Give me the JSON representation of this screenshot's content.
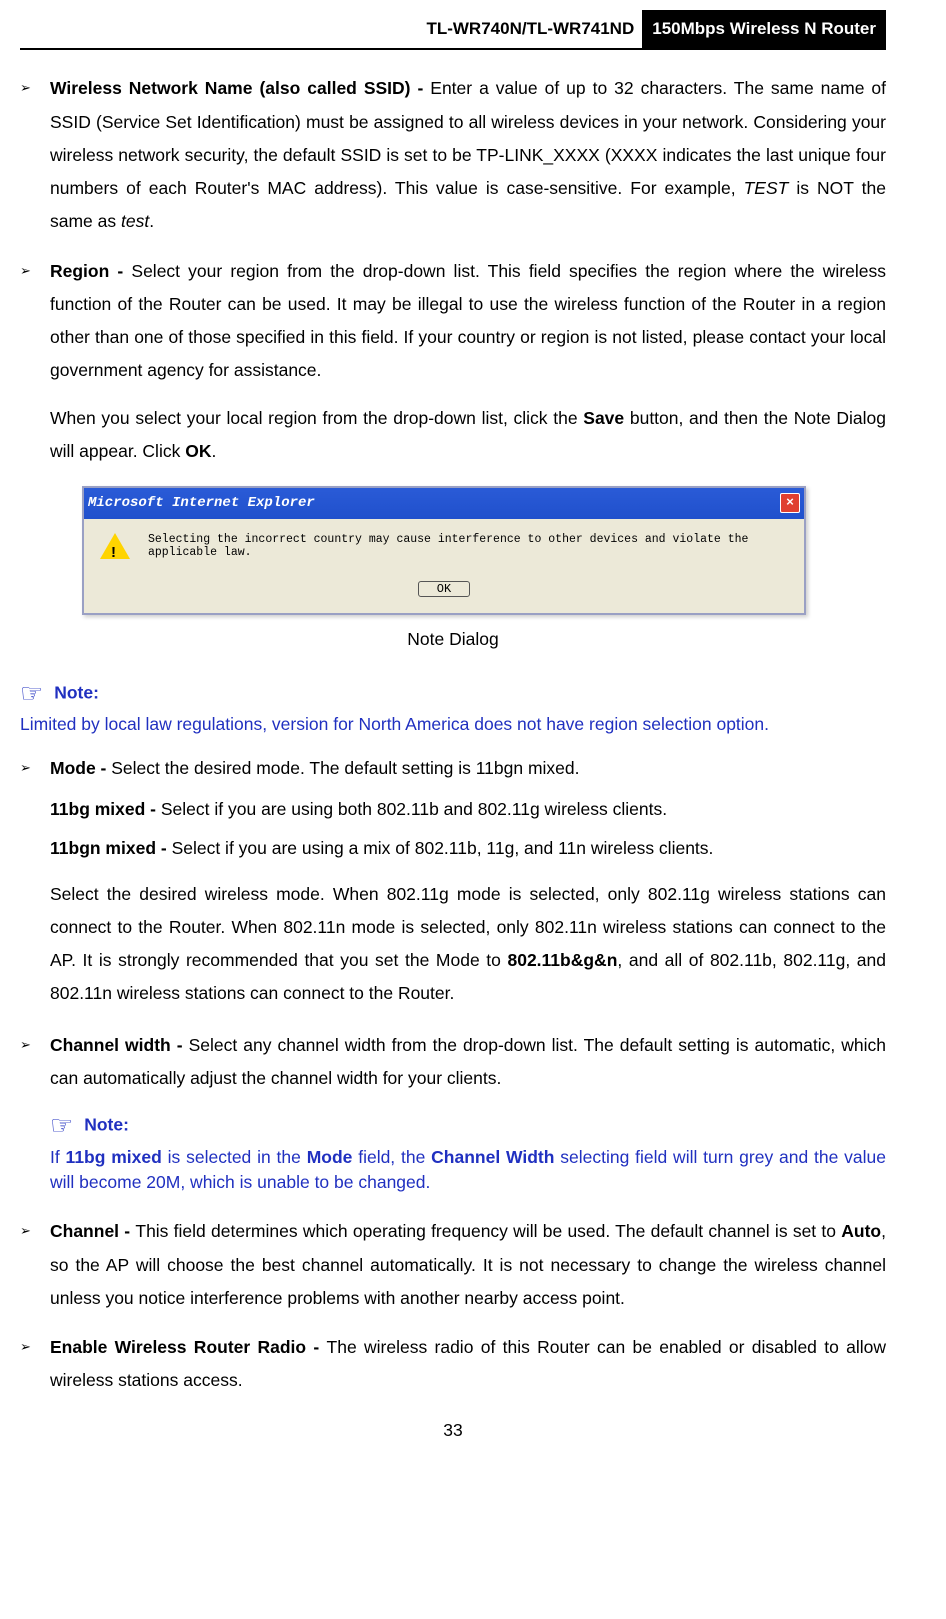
{
  "header": {
    "model": "TL-WR740N/TL-WR741ND",
    "product": "150Mbps Wireless N Router"
  },
  "items": {
    "ssid": {
      "bold": "Wireless Network Name (also called SSID) - ",
      "text_a": "Enter a value of up to 32 characters. The same name of SSID (Service Set Identification) must be assigned to all wireless devices in your network. Considering your wireless network security, the default SSID is set to be TP-LINK_XXXX (XXXX indicates the last unique four numbers of each Router's MAC address). This value is case-sensitive. For example, ",
      "italic1": "TEST",
      "mid": " is NOT the same as ",
      "italic2": "test",
      "end": "."
    },
    "region": {
      "bold": "Region - ",
      "text": "Select your region from the drop-down list. This field specifies the region where the wireless function of the Router can be used. It may be illegal to use the wireless function of the Router in a region other than one of those specified in this field. If your country or region is not listed, please contact your local government agency for assistance.",
      "para2_a": "When you select your local region from the drop-down list, click the ",
      "para2_save": "Save",
      "para2_b": " button, and then the Note Dialog will appear. Click ",
      "para2_ok": "OK",
      "para2_c": "."
    },
    "mode": {
      "bold": "Mode - ",
      "text": "Select the desired mode. The default setting is 11bgn mixed.",
      "l1b": "11bg mixed - ",
      "l1": "Select if you are using both 802.11b and 802.11g wireless clients.",
      "l2b": "11bgn mixed - ",
      "l2": "Select if you are using a mix of 802.11b, 11g, and 11n wireless clients.",
      "para_a": "Select the desired wireless mode. When 802.11g mode is selected, only 802.11g wireless stations can connect to the Router. When 802.11n mode is selected, only 802.11n wireless stations can connect to the AP. It is strongly recommended that you set the Mode to ",
      "para_bold": "802.11b&g&n",
      "para_b": ", and all of 802.11b, 802.11g, and 802.11n wireless stations can connect to the Router."
    },
    "chwidth": {
      "bold": "Channel width - ",
      "text": "Select any channel width from the drop-down list. The default setting is automatic, which can automatically adjust the channel width for your clients.",
      "note_a": "If ",
      "note_b1": "11bg mixed",
      "note_b": " is selected in the ",
      "note_b2": "Mode",
      "note_c": " field, the ",
      "note_b3": "Channel Width",
      "note_d": " selecting field will turn grey and the value will become 20M, which is unable to be changed."
    },
    "channel": {
      "bold": "Channel - ",
      "text_a": "This field determines which operating frequency will be used. The default channel is set to ",
      "auto": "Auto",
      "text_b": ", so the AP will choose the best channel automatically. It is not necessary to change the wireless channel unless you notice interference problems with another nearby access point."
    },
    "radio": {
      "bold": "Enable Wireless Router Radio - ",
      "text": "The wireless radio of this Router can be enabled or disabled to allow wireless stations access."
    }
  },
  "dialog": {
    "title": "Microsoft Internet Explorer",
    "msg": "Selecting the incorrect country may cause interference to other devices and violate the applicable law.",
    "ok": "OK",
    "caption": "Note Dialog"
  },
  "note": {
    "label": "Note:",
    "text": "Limited by local law regulations, version for North America does not have region selection option."
  },
  "page": "33"
}
